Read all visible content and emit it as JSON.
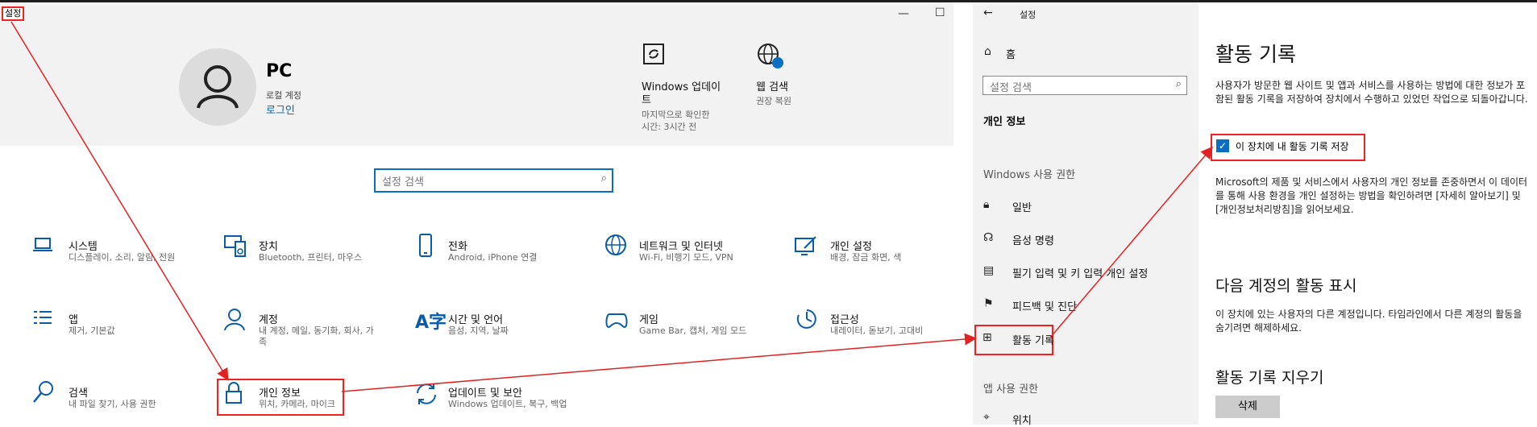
{
  "left_window": {
    "title_label": "설정",
    "minimize_glyph": "—",
    "maximize_glyph": "☐",
    "account": {
      "name": "PC",
      "type": "로컬 계정",
      "signin": "로그인"
    },
    "header_tiles": [
      {
        "title": "Windows 업데이트",
        "sub1": "마지막으로 확인한",
        "sub2": "시간: 3시간 전"
      },
      {
        "title": "웹 검색",
        "sub1": "권장 복원"
      }
    ],
    "search_placeholder": "설정 검색",
    "categories": [
      {
        "title": "시스템",
        "sub": "디스플레이, 소리, 알림, 전원"
      },
      {
        "title": "장치",
        "sub": "Bluetooth, 프린터, 마우스"
      },
      {
        "title": "전화",
        "sub": "Android, iPhone 연결"
      },
      {
        "title": "네트워크 및 인터넷",
        "sub": "Wi-Fi, 비행기 모드, VPN"
      },
      {
        "title": "개인 설정",
        "sub": "배경, 잠금 화면, 색"
      },
      {
        "title": "앱",
        "sub": "제거, 기본값"
      },
      {
        "title": "계정",
        "sub": "내 계정, 메일, 동기화, 회사, 가",
        "sub2": "족"
      },
      {
        "title": "시간 및 언어",
        "sub": "음성, 지역, 날짜"
      },
      {
        "title": "게임",
        "sub": "Game Bar, 캡처, 게임 모드"
      },
      {
        "title": "접근성",
        "sub": "내레이터, 돋보기, 고대비"
      },
      {
        "title": "검색",
        "sub": "내 파일 찾기, 사용 권한"
      },
      {
        "title": "개인 정보",
        "sub": "위치, 카메라, 마이크"
      },
      {
        "title": "업데이트 및 보안",
        "sub": "Windows 업데이트, 복구, 백업"
      }
    ]
  },
  "right_window": {
    "title": "설정",
    "nav": {
      "home": "홈",
      "search_placeholder": "설정 검색",
      "section": "개인 정보",
      "windows_permissions": "Windows 사용 권한",
      "items": [
        "일반",
        "음성 명령",
        "필기 입력 및 키 입력 개인 설정",
        "피드백 및 진단",
        "활동 기록"
      ],
      "app_permissions": "앱 사용 권한",
      "location": "위치"
    },
    "content": {
      "title": "활동 기록",
      "desc": "사용자가 방문한 웹 사이트 및 앱과 서비스를 사용하는 방법에 대한 정보가 포함된 활동 기록을 저장하여 장치에서 수행하고 있었던 작업으로 되돌아갑니다.",
      "checkbox_label": "이 장치에 내 활동 기록 저장",
      "checkbox_checked": true,
      "privacy": "Microsoft의 제품 및 서비스에서 사용자의 개인 정보를 존중하면서 이 데이터를 통해 사용 환경을 개인 설정하는 방법을 확인하려면 [자세히 알아보기] 및 [개인정보처리방침]을 읽어보세요.",
      "accounts_title": "다음 계정의 활동 표시",
      "accounts_desc": "이 장치에 있는 사용자의 다른 계정입니다. 타임라인에서 다른 계정의 활동을 숨기려면 해제하세요.",
      "clear_title": "활동 기록 지우기",
      "clear_button": "삭제"
    }
  },
  "colors": {
    "accent": "#0a6fc2",
    "annotation": "#e22222",
    "panel": "#f2f2f2"
  }
}
